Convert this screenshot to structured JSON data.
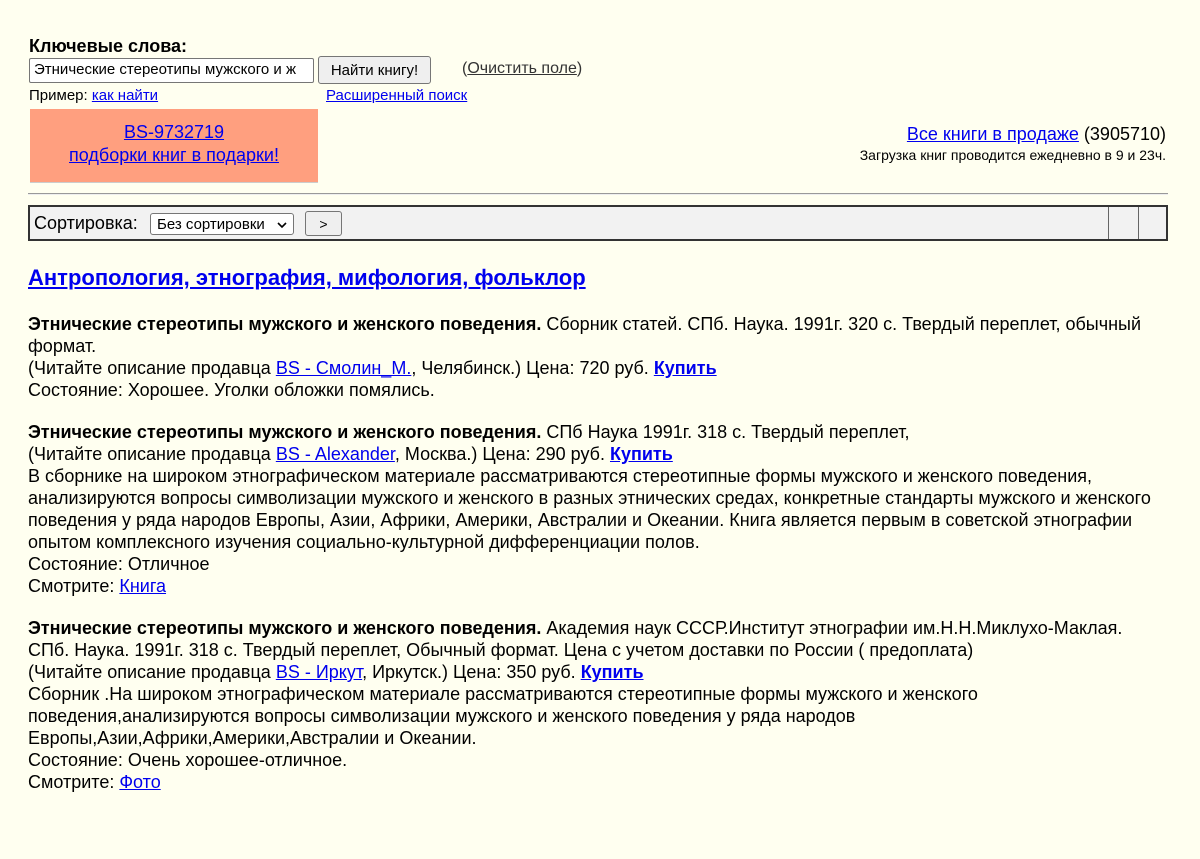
{
  "search": {
    "label": "Ключевые слова:",
    "value": "Этнические стереотипы мужского и ж",
    "button": "Найти книгу!",
    "clear_open": "(",
    "clear_link": "Очистить поле",
    "clear_close": ")",
    "example_prefix": "Пример: ",
    "example_link": "как найти",
    "advanced_link": "Расширенный поиск"
  },
  "promo": {
    "line1": "BS-9732719",
    "line2": "подборки книг в подарки!"
  },
  "header_right": {
    "all_books_link": "Все книги в продаже",
    "count": " (3905710)",
    "load_info": "Загрузка книг проводится ежедневно в 9 и 23ч."
  },
  "sort": {
    "label": "Сортировка:",
    "selected": "Без сортировки",
    "go": ">"
  },
  "section_title": "Антропология, этнография, мифология, фольклор",
  "listings": [
    {
      "title": "Этнические стереотипы мужского и женского поведения.",
      "details": " Сборник статей. СПб. Наука. 1991г. 320 с. Твердый переплет, обычный формат.",
      "seller_prefix": "(Читайте описание продавца ",
      "seller": "BS - Смолин_М.",
      "seller_suffix": ", Челябинск.) Цена: 720 руб. ",
      "buy": "Купить",
      "state": "Состояние: Хорошее. Уголки обложки помялись."
    },
    {
      "title": "Этнические стереотипы мужского и женского поведения.",
      "details": " СПб Наука 1991г. 318 с. Твердый переплет,",
      "seller_prefix": "(Читайте описание продавца ",
      "seller": "BS - Alexander",
      "seller_suffix": ", Москва.) Цена: 290 руб. ",
      "buy": "Купить",
      "description": "В сборнике на широком этнографическом материале рассматриваются стереотипные формы мужского и женского поведения, анализируются вопросы символизации мужского и женского в разных этнических средах, конкретные стандарты мужского и женского поведения у ряда народов Европы, Азии, Африки, Америки, Австралии и Океании. Книга является первым в советской этнографии опытом комплексного изучения социально-культурной дифференциации полов.",
      "state": "Состояние: Отличное",
      "see_prefix": "Смотрите: ",
      "see_link": "Книга"
    },
    {
      "title": "Этнические стереотипы мужского и женского поведения.",
      "details": " Академия наук СССР.Институт этнографии им.Н.Н.Миклухо-Маклая. СПб. Наука. 1991г. 318 с. Твердый переплет, Обычный формат. Цена с учетом доставки по России ( предоплата)",
      "seller_prefix": "(Читайте описание продавца ",
      "seller": "BS - Иркут",
      "seller_suffix": ", Иркутск.) Цена: 350 руб. ",
      "buy": "Купить",
      "description_lines": [
        "Сборник .На широком этнографическом материале рассматриваются стереотипные формы мужского и женского",
        "поведения,анализируются вопросы символизации мужского и женского поведения у ряда народов",
        "Европы,Азии,Африки,Америки,Австралии и Океании."
      ],
      "state": "Состояние: Очень хорошее-отличное.",
      "see_prefix": "Смотрите: ",
      "see_link": "Фото"
    }
  ]
}
